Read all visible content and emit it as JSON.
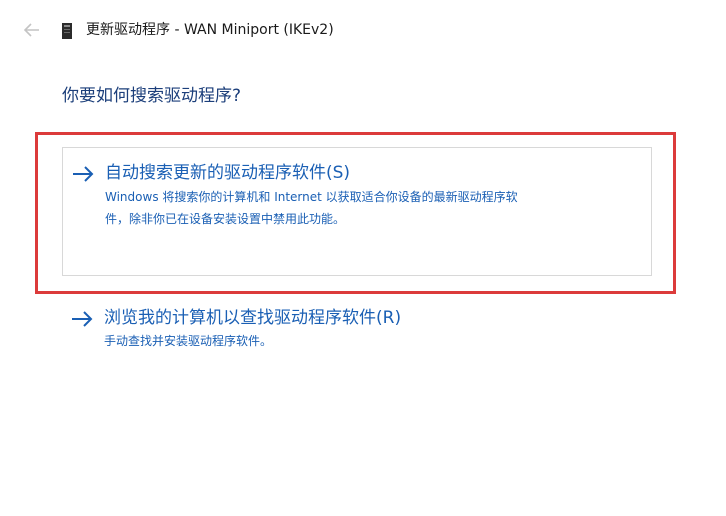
{
  "window": {
    "title": "更新驱动程序 - WAN Miniport (IKEv2)"
  },
  "icons": {
    "back": "back-arrow-icon",
    "device": "device-icon",
    "option_arrow": "arrow-right-icon"
  },
  "main": {
    "question": "你要如何搜索驱动程序?"
  },
  "options": [
    {
      "title": "自动搜索更新的驱动程序软件(S)",
      "description_lines": [
        "Windows 将搜索你的计算机和 Internet 以获取适合你设备的最新驱动程序软",
        "件，除非你已在设备安装设置中禁用此功能。"
      ]
    },
    {
      "title": "浏览我的计算机以查找驱动程序软件(R)",
      "description": "手动查找并安装驱动程序软件。"
    }
  ],
  "colors": {
    "link_blue": "#1a5fb4",
    "heading_blue": "#1b3e7a",
    "highlight_red": "#dc3b3b",
    "option_border": "#d8d8d8"
  }
}
